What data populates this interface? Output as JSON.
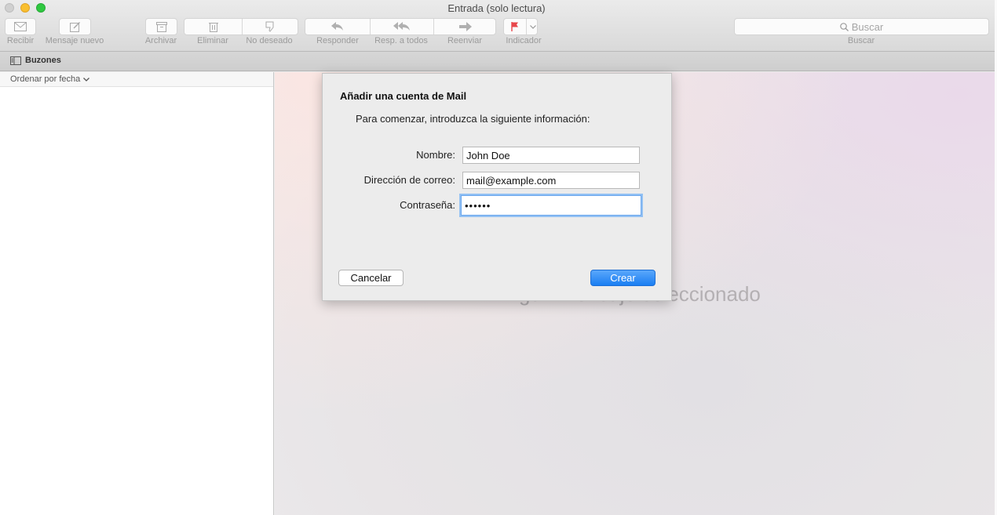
{
  "window": {
    "title": "Entrada (solo lectura)"
  },
  "toolbar": {
    "get_mail": "Recibir",
    "new_message": "Mensaje nuevo",
    "archive": "Archivar",
    "delete": "Eliminar",
    "junk": "No deseado",
    "reply": "Responder",
    "reply_all": "Resp. a todos",
    "forward": "Reenviar",
    "flag": "Indicador",
    "search_placeholder": "Buscar",
    "search_label": "Buscar"
  },
  "favorites": {
    "mailboxes": "Buzones"
  },
  "list": {
    "sort": "Ordenar por fecha"
  },
  "viewer": {
    "empty": "Ningún mensaje seleccionado"
  },
  "dialog": {
    "title": "Añadir una cuenta de Mail",
    "intro": "Para comenzar, introduzca la siguiente información:",
    "name_label": "Nombre:",
    "name_value": "John Doe",
    "email_label": "Dirección de correo:",
    "email_value": "mail@example.com",
    "password_label": "Contraseña:",
    "password_value": "••••••",
    "cancel": "Cancelar",
    "create": "Crear"
  },
  "colors": {
    "accent": "#1a7ef2",
    "flag": "#e8474b"
  }
}
